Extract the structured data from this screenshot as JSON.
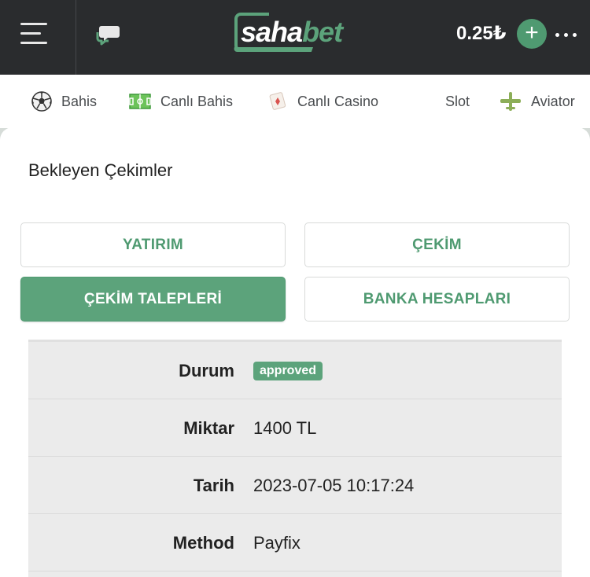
{
  "header": {
    "logo": {
      "part1": "saha",
      "part2": "bet"
    },
    "balance": "0.25₺",
    "add_label": "+"
  },
  "nav": {
    "items": [
      {
        "label": "Bahis",
        "icon": "soccer-ball-icon"
      },
      {
        "label": "Canlı Bahis",
        "icon": "pitch-icon"
      },
      {
        "label": "Canlı Casino",
        "icon": "dice-icon"
      },
      {
        "label": "Slot",
        "icon": ""
      },
      {
        "label": "Aviator",
        "icon": "plane-icon"
      }
    ]
  },
  "page": {
    "title": "Bekleyen Çekimler",
    "tabs": [
      {
        "label": "YATIRIM",
        "active": false
      },
      {
        "label": "ÇEKİM",
        "active": false
      },
      {
        "label": "ÇEKİM TALEPLERİ",
        "active": true
      },
      {
        "label": "BANKA HESAPLARI",
        "active": false
      }
    ]
  },
  "details": {
    "rows": [
      {
        "label": "Durum",
        "value": "approved"
      },
      {
        "label": "Miktar",
        "value": "1400 TL"
      },
      {
        "label": "Tarih",
        "value": "2023-07-05 10:17:24"
      },
      {
        "label": "Method",
        "value": "Payfix"
      }
    ]
  },
  "colors": {
    "brand": "#5ca37b",
    "header_bg": "#2a2c2e"
  }
}
